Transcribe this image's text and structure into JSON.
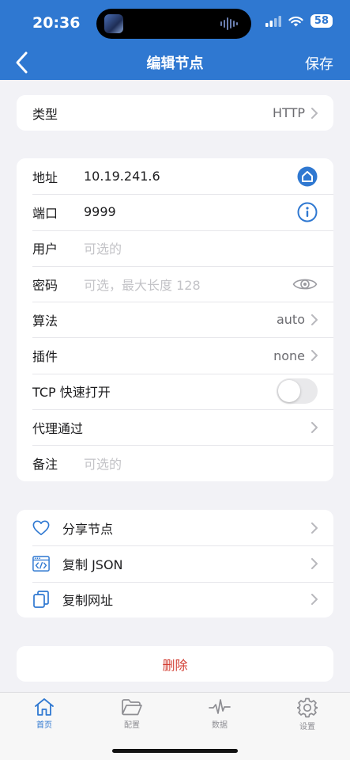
{
  "status_bar": {
    "time": "20:36",
    "battery": "58"
  },
  "nav": {
    "title": "编辑节点",
    "save_label": "保存"
  },
  "type_row": {
    "label": "类型",
    "value": "HTTP"
  },
  "fields": {
    "address": {
      "label": "地址",
      "value": "10.19.241.6"
    },
    "port": {
      "label": "端口",
      "value": "9999"
    },
    "user": {
      "label": "用户",
      "placeholder": "可选的"
    },
    "password": {
      "label": "密码",
      "placeholder": "可选，最大长度 128"
    },
    "algorithm": {
      "label": "算法",
      "value": "auto"
    },
    "plugin": {
      "label": "插件",
      "value": "none"
    },
    "tcp_fast_open": {
      "label": "TCP 快速打开",
      "enabled": false
    },
    "proxy_via": {
      "label": "代理通过"
    },
    "note": {
      "label": "备注",
      "placeholder": "可选的"
    }
  },
  "actions": {
    "share": "分享节点",
    "copy_json": "复制 JSON",
    "copy_url": "复制网址"
  },
  "delete_label": "删除",
  "tabs": [
    {
      "label": "首页",
      "icon": "home-icon"
    },
    {
      "label": "配置",
      "icon": "folder-icon"
    },
    {
      "label": "数据",
      "icon": "pulse-icon"
    },
    {
      "label": "设置",
      "icon": "gear-icon"
    }
  ],
  "colors": {
    "accent": "#2f78d1",
    "danger": "#d23b30",
    "background": "#f2f2f6"
  }
}
